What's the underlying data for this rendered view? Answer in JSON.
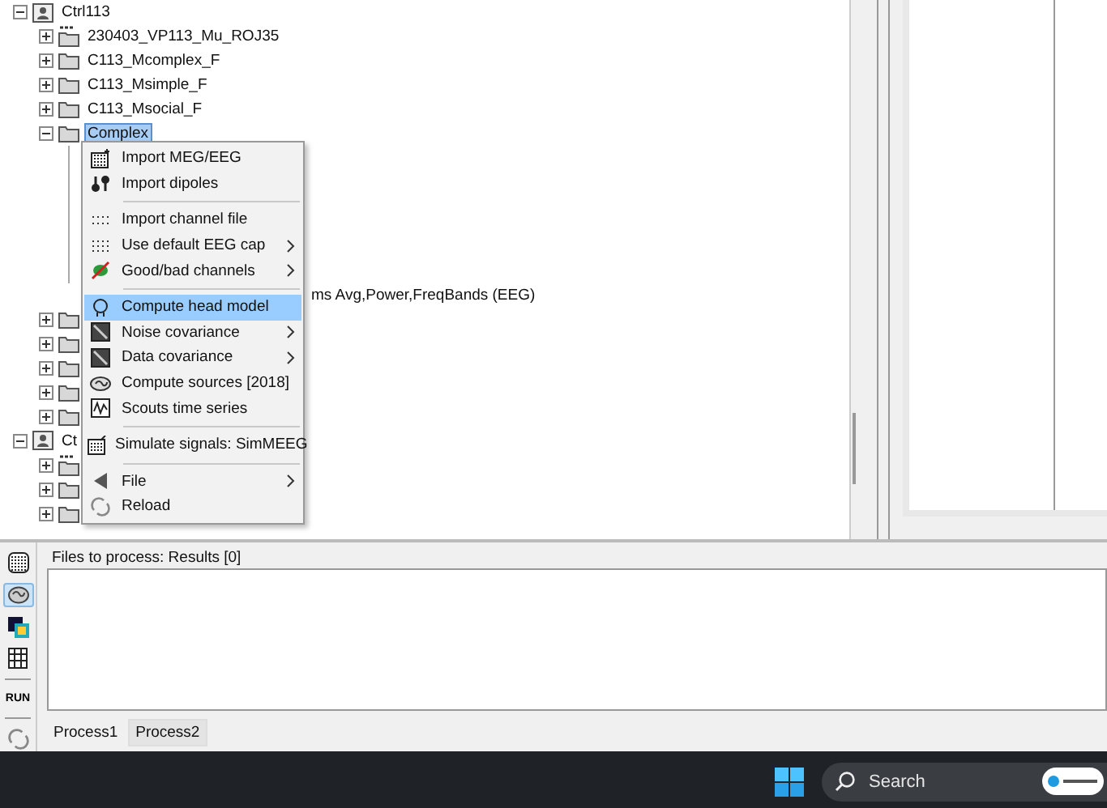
{
  "tree": [
    {
      "kind": "subject",
      "label": "Ctrl113",
      "expanded": true,
      "selected": false,
      "children": [
        {
          "kind": "raw",
          "label": "230403_VP113_Mu_ROJ35",
          "expanded": false,
          "selected": false
        },
        {
          "kind": "folder",
          "label": "C113_Mcomplex_F",
          "expanded": false,
          "selected": false
        },
        {
          "kind": "folder",
          "label": "C113_Msimple_F",
          "expanded": false,
          "selected": false
        },
        {
          "kind": "folder",
          "label": "C113_Msocial_F",
          "expanded": false,
          "selected": false
        },
        {
          "kind": "folder",
          "label": "Complex",
          "expanded": true,
          "selected": true,
          "children": [
            {
              "kind": "file",
              "label": "ms Avg,Power,FreqBands (EEG)",
              "selected": false
            }
          ]
        },
        {
          "kind": "folder",
          "expanded": false,
          "selected": false
        },
        {
          "kind": "folder",
          "expanded": false,
          "selected": false
        },
        {
          "kind": "folder",
          "expanded": false,
          "selected": false
        },
        {
          "kind": "folder",
          "expanded": false,
          "selected": false
        },
        {
          "kind": "folder",
          "expanded": false,
          "selected": false
        }
      ]
    },
    {
      "kind": "subject",
      "label": "Ct",
      "expanded": true,
      "selected": false,
      "children": [
        {
          "kind": "raw",
          "expanded": false,
          "selected": false
        },
        {
          "kind": "folder",
          "expanded": false,
          "selected": false
        },
        {
          "kind": "folder",
          "expanded": false,
          "selected": false
        }
      ]
    }
  ],
  "context_menu": [
    {
      "kind": "item",
      "label": "Import MEG/EEG",
      "submenu": false,
      "selected": false
    },
    {
      "kind": "item",
      "label": "Import dipoles",
      "submenu": false,
      "selected": false
    },
    {
      "kind": "separator"
    },
    {
      "kind": "item",
      "label": "Import channel file",
      "submenu": false,
      "selected": false
    },
    {
      "kind": "item",
      "label": "Use default EEG cap",
      "submenu": true,
      "selected": false
    },
    {
      "kind": "item",
      "label": "Good/bad channels",
      "submenu": true,
      "selected": false
    },
    {
      "kind": "separator"
    },
    {
      "kind": "item",
      "label": "Compute head model",
      "submenu": false,
      "selected": true
    },
    {
      "kind": "item",
      "label": "Noise covariance",
      "submenu": true,
      "selected": false
    },
    {
      "kind": "item",
      "label": "Data covariance",
      "submenu": true,
      "selected": false
    },
    {
      "kind": "item",
      "label": "Compute sources [2018]",
      "submenu": false,
      "selected": false
    },
    {
      "kind": "item",
      "label": "Scouts time series",
      "submenu": false,
      "selected": false
    },
    {
      "kind": "separator"
    },
    {
      "kind": "item",
      "label": "Simulate signals: SimMEEG",
      "submenu": false,
      "selected": false
    },
    {
      "kind": "separator"
    },
    {
      "kind": "item",
      "label": "File",
      "submenu": true,
      "selected": false
    },
    {
      "kind": "item",
      "label": "Reload",
      "submenu": false,
      "selected": false
    }
  ],
  "process_toolbar": [
    {
      "kind": "icon",
      "selected": false
    },
    {
      "kind": "icon",
      "selected": true
    },
    {
      "kind": "icon",
      "selected": false
    },
    {
      "kind": "icon",
      "selected": false
    },
    {
      "kind": "text",
      "label": "RUN",
      "selected": false
    },
    {
      "kind": "icon",
      "selected": false
    }
  ],
  "process_panel": {
    "title": "Files to process: Results [0]"
  },
  "process_tabs": [
    {
      "label": "Process1",
      "selected": true
    },
    {
      "label": "Process2",
      "selected": false
    }
  ],
  "taskbar": {
    "search": {
      "placeholder": "Search"
    }
  }
}
